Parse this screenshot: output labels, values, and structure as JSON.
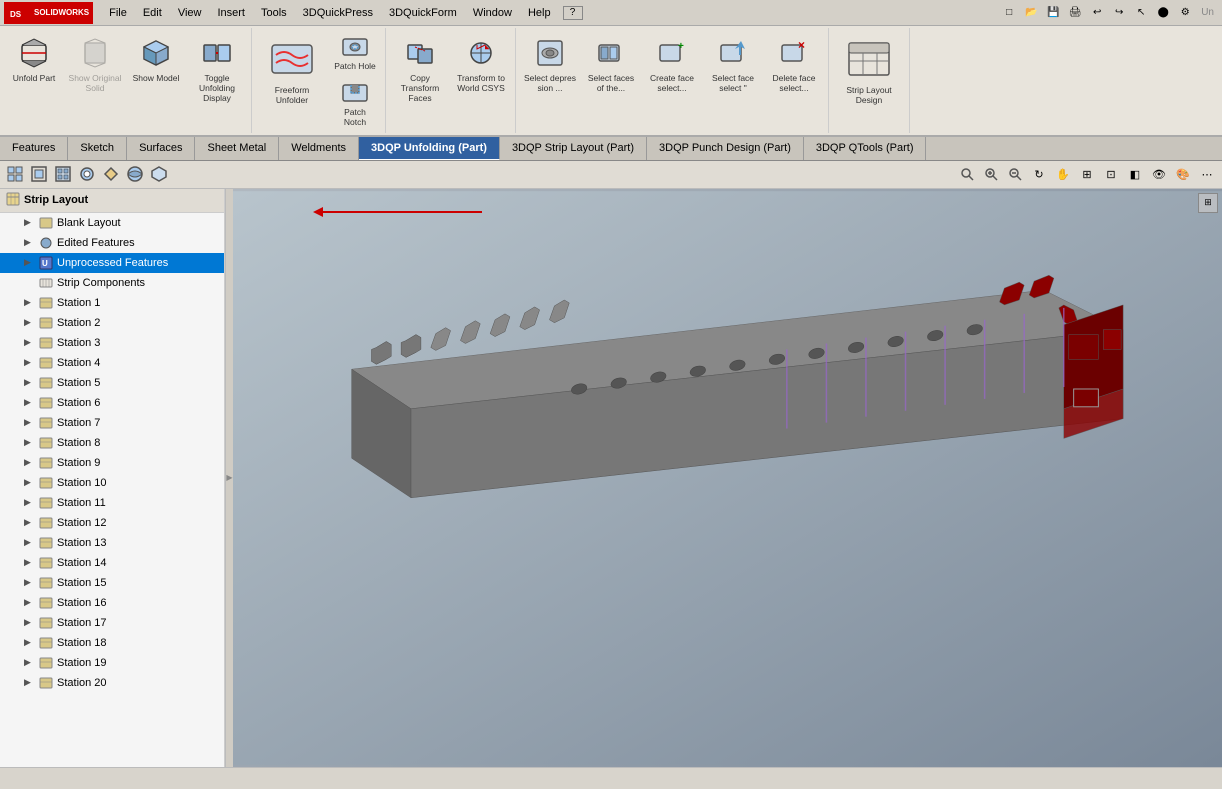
{
  "app": {
    "name": "SOLIDWORKS",
    "title": "SOLIDWORKS",
    "version": ""
  },
  "menubar": {
    "items": [
      "File",
      "Edit",
      "View",
      "Insert",
      "Tools",
      "3DQuickPress",
      "3DQuickForm",
      "Window",
      "Help"
    ]
  },
  "ribbon": {
    "groups": [
      {
        "buttons": [
          {
            "id": "unfold-part",
            "label": "Unfold Part",
            "icon": "unfold",
            "disabled": false,
            "large": false
          },
          {
            "id": "show-original-solid",
            "label": "Show Original Solid",
            "icon": "show-solid",
            "disabled": true,
            "large": false
          },
          {
            "id": "show-unfolding-model",
            "label": "Show Model",
            "icon": "show-model",
            "disabled": false,
            "large": false
          },
          {
            "id": "toggle-unfolding-display",
            "label": "Toggle Unfolding Display",
            "icon": "toggle-unfold",
            "disabled": false,
            "large": false
          }
        ]
      },
      {
        "buttons": [
          {
            "id": "freeform-unfolder",
            "label": "Freeform Unfolder",
            "icon": "freeform",
            "disabled": false,
            "large": true
          },
          {
            "id": "patch-hole",
            "label": "Patch Hole",
            "icon": "patch-hole",
            "disabled": false,
            "large": false
          },
          {
            "id": "patch-notch",
            "label": "Patch Notch",
            "icon": "patch-notch",
            "disabled": false,
            "large": false
          }
        ]
      },
      {
        "buttons": [
          {
            "id": "copy-transform-faces",
            "label": "Copy Transform Faces",
            "icon": "copy-transform",
            "disabled": false,
            "large": false
          },
          {
            "id": "transform-to-world-csys",
            "label": "Transform to World CSYS",
            "icon": "transform-world",
            "disabled": false,
            "large": false
          }
        ]
      },
      {
        "buttons": [
          {
            "id": "select-depression",
            "label": "Select depres sion ...",
            "icon": "select-dep",
            "disabled": false,
            "large": false
          },
          {
            "id": "select-faces-of-the",
            "label": "Select faces of the...",
            "icon": "select-faces",
            "disabled": false,
            "large": false
          },
          {
            "id": "create-face-select",
            "label": "Create face select...",
            "icon": "create-face",
            "disabled": false,
            "large": false
          },
          {
            "id": "select-face-select",
            "label": "Select face select \"",
            "icon": "select-face",
            "disabled": false,
            "large": false
          },
          {
            "id": "delete-face-select",
            "label": "Delete face select...",
            "icon": "delete-face",
            "disabled": false,
            "large": false
          }
        ]
      },
      {
        "buttons": [
          {
            "id": "strip-layout-design",
            "label": "Strip Layout Design",
            "icon": "strip-layout",
            "disabled": false,
            "large": true
          }
        ]
      }
    ]
  },
  "tabs": [
    {
      "id": "features",
      "label": "Features",
      "active": false
    },
    {
      "id": "sketch",
      "label": "Sketch",
      "active": false
    },
    {
      "id": "surfaces",
      "label": "Surfaces",
      "active": false
    },
    {
      "id": "sheet-metal",
      "label": "Sheet Metal",
      "active": false
    },
    {
      "id": "weldments",
      "label": "Weldments",
      "active": false
    },
    {
      "id": "3dqp-unfolding",
      "label": "3DQP Unfolding (Part)",
      "active": true,
      "highlight": true
    },
    {
      "id": "3dqp-strip-layout",
      "label": "3DQP Strip Layout (Part)",
      "active": false,
      "highlight": false
    },
    {
      "id": "3dqp-punch-design",
      "label": "3DQP Punch Design (Part)",
      "active": false,
      "highlight": false
    },
    {
      "id": "3dqp-qtools",
      "label": "3DQP QTools (Part)",
      "active": false,
      "highlight": false
    }
  ],
  "sidebar": {
    "header": "Strip Layout",
    "tree": [
      {
        "id": "strip-layout",
        "label": "Strip Layout",
        "level": 0,
        "expand": true,
        "icon": "strip",
        "selected": false
      },
      {
        "id": "blank-layout",
        "label": "Blank Layout",
        "level": 1,
        "expand": true,
        "icon": "blank",
        "selected": false
      },
      {
        "id": "edited-features",
        "label": "Edited Features",
        "level": 1,
        "expand": false,
        "icon": "features",
        "selected": false
      },
      {
        "id": "unprocessed-features",
        "label": "Unprocessed Features",
        "level": 1,
        "expand": false,
        "icon": "unprocessed",
        "selected": true
      },
      {
        "id": "strip-components",
        "label": "Strip Components",
        "level": 1,
        "expand": false,
        "icon": "components",
        "selected": false
      },
      {
        "id": "station-1",
        "label": "Station 1",
        "level": 1,
        "expand": false,
        "icon": "station",
        "selected": false
      },
      {
        "id": "station-2",
        "label": "Station 2",
        "level": 1,
        "expand": false,
        "icon": "station",
        "selected": false
      },
      {
        "id": "station-3",
        "label": "Station 3",
        "level": 1,
        "expand": true,
        "icon": "station",
        "selected": false
      },
      {
        "id": "station-4",
        "label": "Station 4",
        "level": 1,
        "expand": false,
        "icon": "station",
        "selected": false
      },
      {
        "id": "station-5",
        "label": "Station 5",
        "level": 1,
        "expand": false,
        "icon": "station",
        "selected": false
      },
      {
        "id": "station-6",
        "label": "Station 6",
        "level": 1,
        "expand": false,
        "icon": "station",
        "selected": false
      },
      {
        "id": "station-7",
        "label": "Station 7",
        "level": 1,
        "expand": false,
        "icon": "station",
        "selected": false
      },
      {
        "id": "station-8",
        "label": "Station 8",
        "level": 1,
        "expand": false,
        "icon": "station",
        "selected": false
      },
      {
        "id": "station-9",
        "label": "Station 9",
        "level": 1,
        "expand": false,
        "icon": "station",
        "selected": false
      },
      {
        "id": "station-10",
        "label": "Station 10",
        "level": 1,
        "expand": true,
        "icon": "station",
        "selected": false
      },
      {
        "id": "station-11",
        "label": "Station 11",
        "level": 1,
        "expand": false,
        "icon": "station",
        "selected": false
      },
      {
        "id": "station-12",
        "label": "Station 12",
        "level": 1,
        "expand": false,
        "icon": "station",
        "selected": false
      },
      {
        "id": "station-13",
        "label": "Station 13",
        "level": 1,
        "expand": false,
        "icon": "station",
        "selected": false
      },
      {
        "id": "station-14",
        "label": "Station 14",
        "level": 1,
        "expand": true,
        "icon": "station",
        "selected": false
      },
      {
        "id": "station-15",
        "label": "Station 15",
        "level": 1,
        "expand": false,
        "icon": "station",
        "selected": false
      },
      {
        "id": "station-16",
        "label": "Station 16",
        "level": 1,
        "expand": false,
        "icon": "station",
        "selected": false
      },
      {
        "id": "station-17",
        "label": "Station 17",
        "level": 1,
        "expand": false,
        "icon": "station",
        "selected": false
      },
      {
        "id": "station-18",
        "label": "Station 18",
        "level": 1,
        "expand": true,
        "icon": "station",
        "selected": false
      },
      {
        "id": "station-19",
        "label": "Station 19",
        "level": 1,
        "expand": false,
        "icon": "station",
        "selected": false
      },
      {
        "id": "station-20",
        "label": "Station 20",
        "level": 1,
        "expand": false,
        "icon": "station",
        "selected": false
      }
    ]
  },
  "iconbar": {
    "icons": [
      "⊞",
      "⊡",
      "▣",
      "⊙",
      "◈",
      "◑",
      "⬡"
    ]
  },
  "viewport": {
    "bg_color_start": "#a8b0b8",
    "bg_color_end": "#707880"
  },
  "statusbar": {
    "text": ""
  }
}
